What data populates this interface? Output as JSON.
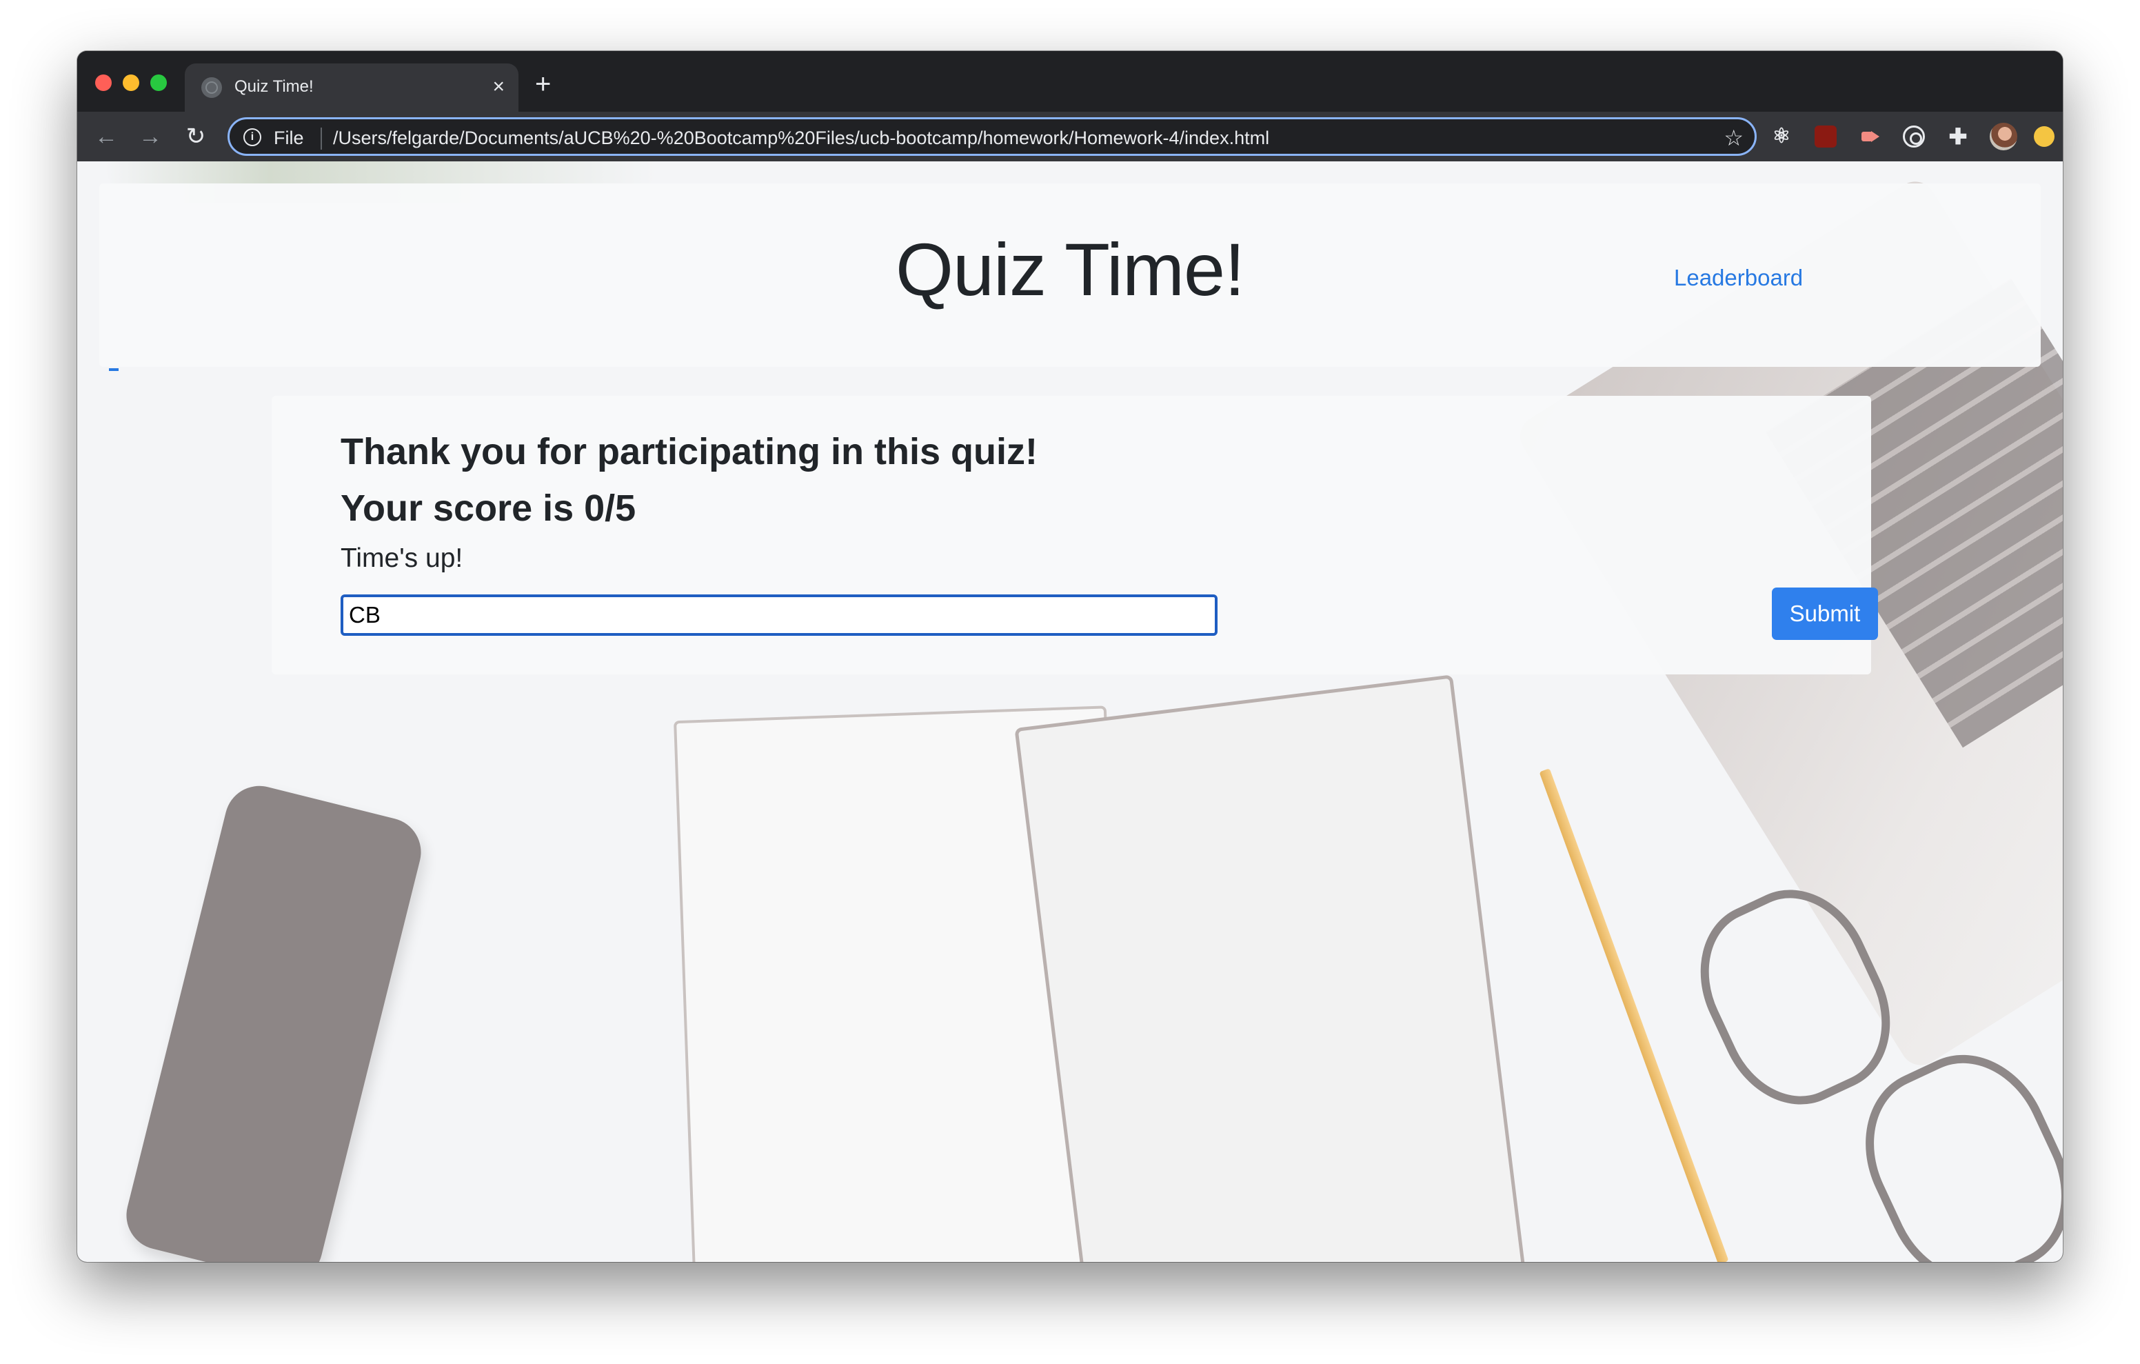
{
  "browser": {
    "tab_title": "Quiz Time!",
    "tab_close_icon": "×",
    "new_tab_icon": "+",
    "address_scheme": "File",
    "address_url": "/Users/felgarde/Documents/aUCB%20-%20Bootcamp%20Files/ucb-bootcamp/homework/Homework-4/index.html",
    "omnibox_focus_color": "#8ab4f8"
  },
  "header": {
    "title": "Quiz Time!",
    "leaderboard_link": "Leaderboard"
  },
  "result": {
    "thanks_message": "Thank you for participating in this quiz!",
    "score_message": "Your score is 0/5",
    "status_message": "Time's up!",
    "initials_value": "CB",
    "submit_label": "Submit"
  },
  "colors": {
    "accent": "#2f80ed",
    "link": "#2779e2",
    "card_bg": "#f8f9fa"
  }
}
